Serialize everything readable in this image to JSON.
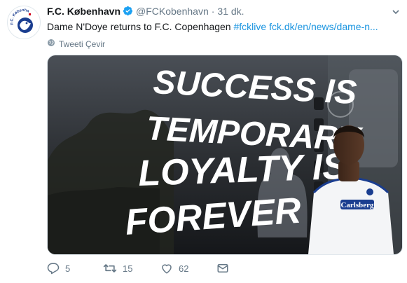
{
  "tweet": {
    "author_name": "F.C. København",
    "handle": "@FCKobenhavn",
    "separator": "·",
    "time": "31 dk.",
    "text_plain": "Dame N'Doye returns to F.C. Copenhagen ",
    "hashtag": "#fcklive",
    "link": "fck.dk/en/news/dame-n...",
    "translate_label": "Tweeti Çevir",
    "avatar_text": "F.C. København",
    "media": {
      "line1": "SUCCESS IS",
      "line2": "TEMPORARY",
      "line3": "LOYALTY IS",
      "line4": "FOREVER",
      "shirt_sponsor": "Carlsberg"
    },
    "actions": {
      "replies": "5",
      "retweets": "15",
      "likes": "62"
    }
  },
  "colors": {
    "link": "#1b95e0",
    "secondary": "#657786",
    "verified": "#1da1f2",
    "club_blue": "#1a3d8f"
  },
  "icons": [
    "verified-badge-icon",
    "chevron-down-icon",
    "globe-icon",
    "reply-icon",
    "retweet-icon",
    "like-icon",
    "direct-message-icon"
  ]
}
